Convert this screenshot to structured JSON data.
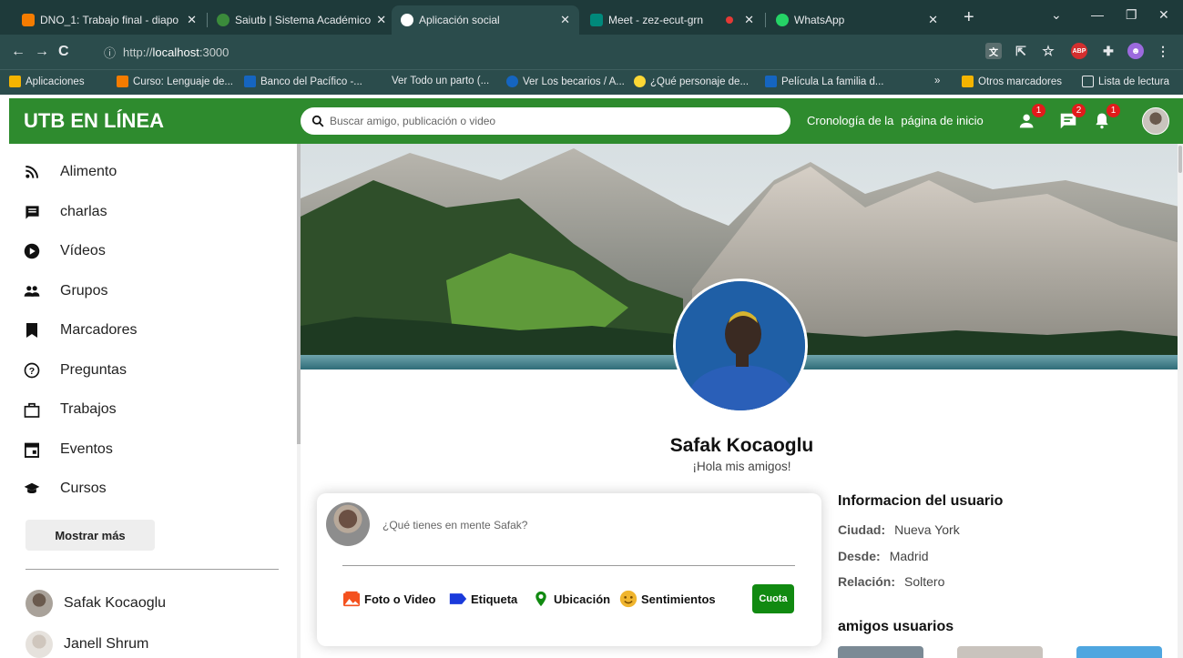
{
  "browser": {
    "tabs": [
      {
        "label": "DNO_1: Trabajo final - diapo",
        "color": "#f57c00"
      },
      {
        "label": "Saiutb | Sistema Académico",
        "color": "#3b8b3b"
      },
      {
        "label": "Aplicación social",
        "color": "#ffffff"
      },
      {
        "label": "Meet - zez-ecut-grn",
        "color": "#00897b"
      },
      {
        "label": "WhatsApp",
        "color": "#25d366"
      }
    ],
    "address": {
      "prefix": "http://",
      "host": "localhost",
      "port": ":3000"
    },
    "bookmarks": [
      {
        "label": "Aplicaciones",
        "color": "#f4b400"
      },
      {
        "label": "Curso: Lenguaje de...",
        "color": "#f57c00"
      },
      {
        "label": "Banco del Pacífico -...",
        "color": "#1565c0"
      },
      {
        "label": "Ver Todo un parto (...",
        "color": "#2b4c4c"
      },
      {
        "label": "Ver Los becarios / A...",
        "color": "#1565c0"
      },
      {
        "label": "¿Qué personaje de...",
        "color": "#fdd835"
      },
      {
        "label": "Película La familia d...",
        "color": "#1565c0"
      },
      {
        "label": "»",
        "color": "#2b4c4c"
      },
      {
        "label": "Otros marcadores",
        "color": "#f4b400"
      },
      {
        "label": "Lista de lectura",
        "color": "#2b4c4c"
      }
    ]
  },
  "app": {
    "logo": "UTB EN LÍNEA",
    "search_placeholder": "Buscar amigo, publicación o video",
    "top_links": [
      "Cronología de la",
      "página de inicio"
    ],
    "badges": {
      "friends": "1",
      "messages": "2",
      "notifications": "1"
    },
    "brand_color": "#2e8b2e"
  },
  "sidebar": {
    "items": [
      {
        "label": "Alimento",
        "icon": "rss-icon"
      },
      {
        "label": "charlas",
        "icon": "chat-icon"
      },
      {
        "label": "Vídeos",
        "icon": "play-circle-icon"
      },
      {
        "label": "Grupos",
        "icon": "group-icon"
      },
      {
        "label": "Marcadores",
        "icon": "bookmark-icon"
      },
      {
        "label": "Preguntas",
        "icon": "help-circle-icon"
      },
      {
        "label": "Trabajos",
        "icon": "briefcase-icon"
      },
      {
        "label": "Eventos",
        "icon": "calendar-icon"
      },
      {
        "label": "Cursos",
        "icon": "school-icon"
      }
    ],
    "more_label": "Mostrar más",
    "friends": [
      {
        "name": "Safak Kocaoglu"
      },
      {
        "name": "Janell Shrum"
      }
    ]
  },
  "profile": {
    "name": "Safak Kocaoglu",
    "description": "¡Hola mis amigos!"
  },
  "share": {
    "placeholder": "¿Qué tienes en mente Safak?",
    "options": [
      "Foto o Video",
      "Etiqueta",
      "Ubicación",
      "Sentimientos"
    ],
    "submit_label": "Cuota"
  },
  "user_info": {
    "title": "Informacion del usuario",
    "rows": [
      {
        "key": "Ciudad:",
        "value": "Nueva York"
      },
      {
        "key": "Desde:",
        "value": "Madrid"
      },
      {
        "key": "Relación:",
        "value": "Soltero"
      }
    ]
  },
  "friends_title": "amigos usuarios"
}
